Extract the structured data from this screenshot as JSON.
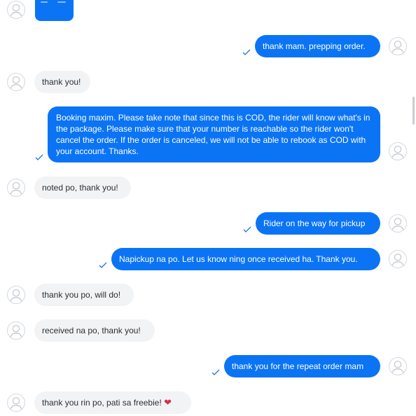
{
  "chat": {
    "messages": [
      {
        "from": "customer",
        "type": "image"
      },
      {
        "from": "seller",
        "text": "thank mam. prepping order."
      },
      {
        "from": "customer",
        "text": "thank you!"
      },
      {
        "from": "seller",
        "text": "Booking maxim. Please take note that since this is COD, the rider will know what's in the package. Please make sure that your number is reachable so the rider won't cancel the order. If the order is canceled, we will not be able to rebook as COD with your account. Thanks."
      },
      {
        "from": "customer",
        "text": "noted po, thank you!"
      },
      {
        "from": "seller",
        "text": "Rider on the way for pickup"
      },
      {
        "from": "seller",
        "text": "Napickup na po. Let us know ning once received ha. Thank you."
      },
      {
        "from": "customer",
        "text": "thank you po, will do!"
      },
      {
        "from": "customer",
        "text": "received na po, thank you!"
      },
      {
        "from": "seller",
        "text": "thank you for the repeat order mam"
      },
      {
        "from": "customer",
        "text": "thank you rin po, pati sa freebie!",
        "emoji": "heart-icon"
      }
    ]
  },
  "colors": {
    "outgoing_bubble": "#0b74f5",
    "incoming_bubble": "#f2f3f5",
    "read_tick": "#1a73e8"
  }
}
